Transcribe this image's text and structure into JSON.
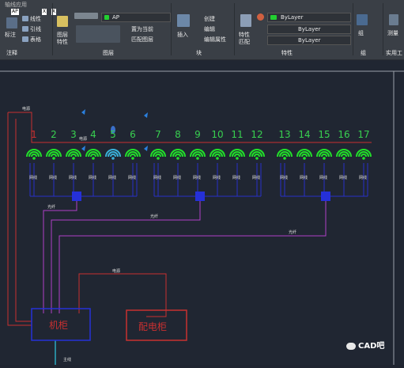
{
  "ribbon": {
    "top_tab": "轴线应用",
    "mini_badges": [
      "AP",
      "X",
      "X"
    ],
    "annotate": {
      "label": "标注",
      "linear": "线性",
      "leader": "引线",
      "table": "表格",
      "section": "注释"
    },
    "layers": {
      "layer_props": "图层",
      "layer_props2": "特性",
      "current": "AP",
      "set_current": "置为当前",
      "match_layer": "匹配图层",
      "section": "图层"
    },
    "block": {
      "insert": "插入",
      "create": "创建",
      "edit": "编辑",
      "edit_attr": "编辑属性",
      "section": "块"
    },
    "properties": {
      "match": "特性",
      "match2": "匹配",
      "color": "ByLayer",
      "linetype": "ByLayer",
      "lineweight": "ByLayer",
      "section": "特性"
    },
    "groups": {
      "group": "组",
      "section": "组"
    },
    "utilities": {
      "measure": "测量",
      "section": "实用工"
    }
  },
  "drawing": {
    "ap_numbers": [
      "1",
      "2",
      "3",
      "4",
      "5",
      "6",
      "7",
      "8",
      "9",
      "10",
      "11",
      "12",
      "13",
      "14",
      "15",
      "16",
      "17"
    ],
    "leaf_label": "网线",
    "power_label": "电源",
    "fiber_label": "光纤",
    "main_cable_label": "主线",
    "cabinet_label": "机柜",
    "distribution_label": "配电柜"
  },
  "watermark": "CAD吧",
  "colors": {
    "wifi": "#22e02a",
    "wifi_alt": "#3ab0d8",
    "cabinet": "#2530d8",
    "power": "#c83030",
    "fiber": "#b040c8",
    "numbers": "#38d050",
    "numbers_first": "#c83030"
  }
}
